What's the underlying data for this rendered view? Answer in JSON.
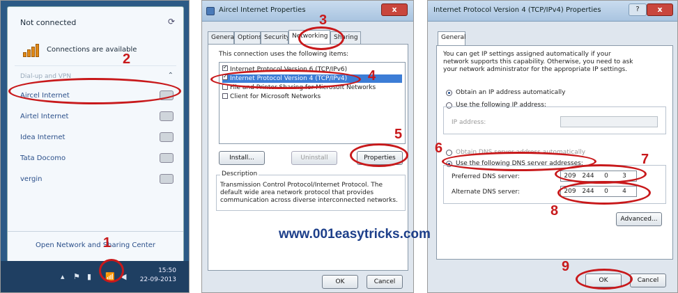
{
  "panel1": {
    "status": "Not connected",
    "connections": "Connections are available",
    "section": "Dial-up and VPN",
    "networks": [
      "Aircel Internet",
      "Airtel Internet",
      "Idea Internet",
      "Tata Docomo",
      "vergin"
    ],
    "open_center": "Open Network and Sharing Center",
    "clock_time": "15:50",
    "clock_date": "22-09-2013"
  },
  "panel2": {
    "title": "Aircel Internet Properties",
    "close": "x",
    "tabs": [
      "General",
      "Options",
      "Security",
      "Networking",
      "Sharing"
    ],
    "uses_label": "This connection uses the following items:",
    "items": [
      "Internet Protocol Version 6 (TCP/IPv6)",
      "Internet Protocol Version 4 (TCP/IPv4)",
      "File and Printer Sharing for Microsoft Networks",
      "Client for Microsoft Networks"
    ],
    "install": "Install...",
    "uninstall": "Uninstall",
    "properties": "Properties",
    "description_label": "Description",
    "description": "Transmission Control Protocol/Internet Protocol. The default wide area network protocol that provides communication across diverse interconnected networks.",
    "ok": "OK",
    "cancel": "Cancel"
  },
  "panel3": {
    "title": "Internet Protocol Version 4 (TCP/IPv4) Properties",
    "help": "?",
    "close": "x",
    "tab": "General",
    "intro": "You can get IP settings assigned automatically if your network supports this capability. Otherwise, you need to ask your network administrator for the appropriate IP settings.",
    "obtain_ip": "Obtain an IP address automatically",
    "use_ip": "Use the following IP address:",
    "ip_address": "IP address:",
    "obtain_dns": "Obtain DNS server address automatically",
    "use_dns": "Use the following DNS server addresses:",
    "preferred": "Preferred DNS server:",
    "alternate": "Alternate DNS server:",
    "preferred_ip": [
      "209",
      "244",
      "0",
      "3"
    ],
    "alternate_ip": [
      "209",
      "244",
      "0",
      "4"
    ],
    "advanced": "Advanced...",
    "ok": "OK",
    "cancel": "Cancel"
  },
  "annotations": [
    "1",
    "2",
    "3",
    "4",
    "5",
    "6",
    "7",
    "8",
    "9"
  ],
  "watermark": "www.001easytricks.com",
  "colors": {
    "annotation": "#c8191b",
    "watermark": "#1d3f8a",
    "taskbar": "#1f3f62"
  }
}
